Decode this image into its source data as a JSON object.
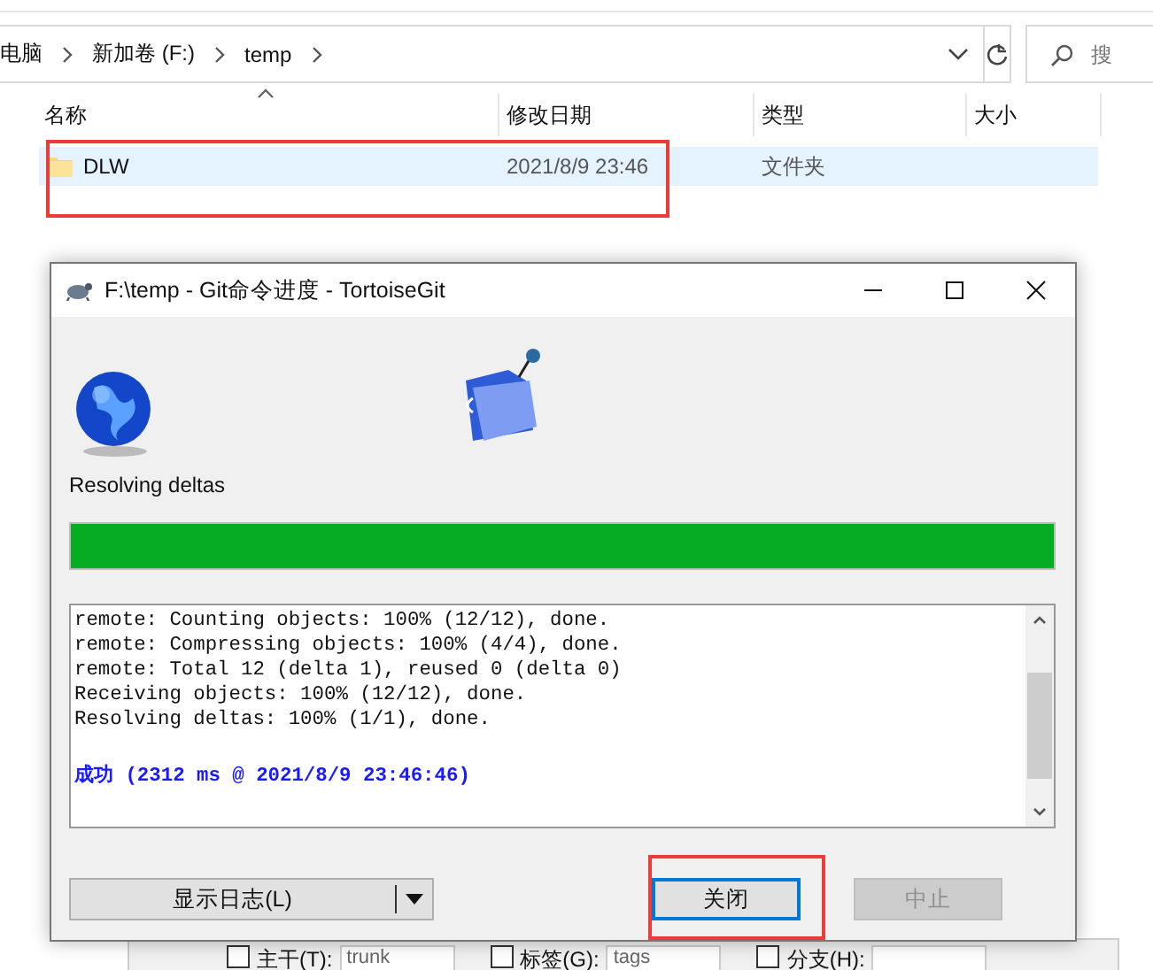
{
  "explorer": {
    "breadcrumb": [
      "电脑",
      "新加卷 (F:)",
      "temp"
    ],
    "search": {
      "placeholder": "搜"
    },
    "columns": [
      "名称",
      "修改日期",
      "类型",
      "大小"
    ],
    "rows": [
      {
        "name": "DLW",
        "modified": "2021/8/9 23:46",
        "type": "文件夹",
        "selected": true,
        "highlighted": true
      }
    ]
  },
  "background_panel": {
    "items": [
      {
        "label": "主干(T):",
        "value": "trunk",
        "checked": false
      },
      {
        "label": "标签(G):",
        "value": "tags",
        "checked": false
      },
      {
        "label": "分支(H):",
        "value": "",
        "checked": false
      }
    ]
  },
  "dialog": {
    "title": "F:\\temp - Git命令进度 - TortoiseGit",
    "status": "Resolving deltas",
    "progress": {
      "level": 1
    },
    "log": [
      {
        "kind": "normal",
        "text": "remote: Counting objects: 100% (12/12), done."
      },
      {
        "kind": "normal",
        "text": "remote: Compressing objects: 100% (4/4), done."
      },
      {
        "kind": "normal",
        "text": "remote: Total 12 (delta 1), reused 0 (delta 0)"
      },
      {
        "kind": "normal",
        "text": "Receiving objects: 100% (12/12), done."
      },
      {
        "kind": "normal",
        "text": "Resolving deltas: 100% (1/1), done."
      },
      {
        "kind": "success",
        "text": "成功 (2312 ms @ 2021/8/9 23:46:46)"
      }
    ],
    "buttons": [
      {
        "kind": "split",
        "label": "显示日志(L)"
      },
      {
        "kind": "plain",
        "label": "关闭",
        "focused": true,
        "disabled": false,
        "highlighted": true
      },
      {
        "kind": "plain",
        "label": "中止",
        "focused": false,
        "disabled": true,
        "highlighted": false
      }
    ]
  }
}
